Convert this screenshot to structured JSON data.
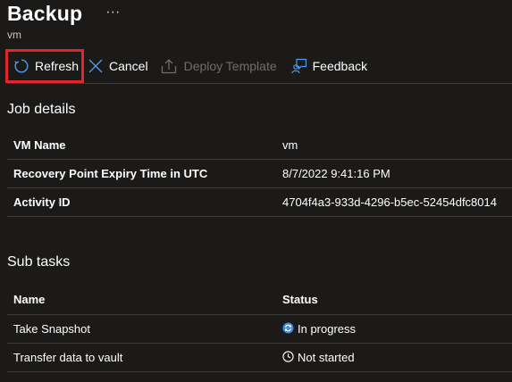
{
  "header": {
    "title": "Backup",
    "more_label": "···",
    "subtitle": "vm"
  },
  "toolbar": {
    "refresh_label": "Refresh",
    "cancel_label": "Cancel",
    "deploy_label": "Deploy Template",
    "feedback_label": "Feedback"
  },
  "job_details": {
    "title": "Job details",
    "rows": [
      {
        "label": "VM Name",
        "value": "vm"
      },
      {
        "label": "Recovery Point Expiry Time in UTC",
        "value": "8/7/2022 9:41:16 PM"
      },
      {
        "label": "Activity ID",
        "value": "4704f4a3-933d-4296-b5ec-52454dfc8014"
      }
    ]
  },
  "sub_tasks": {
    "title": "Sub tasks",
    "headers": {
      "name": "Name",
      "status": "Status"
    },
    "rows": [
      {
        "name": "Take Snapshot",
        "status": "In progress",
        "icon": "sync-icon"
      },
      {
        "name": "Transfer data to vault",
        "status": "Not started",
        "icon": "clock-icon"
      }
    ]
  },
  "colors": {
    "background": "#1b1a19",
    "highlight": "#e0262b",
    "accent": "#4f9ce8",
    "disabled": "#6e6d6c",
    "divider": "#3b3a39"
  }
}
